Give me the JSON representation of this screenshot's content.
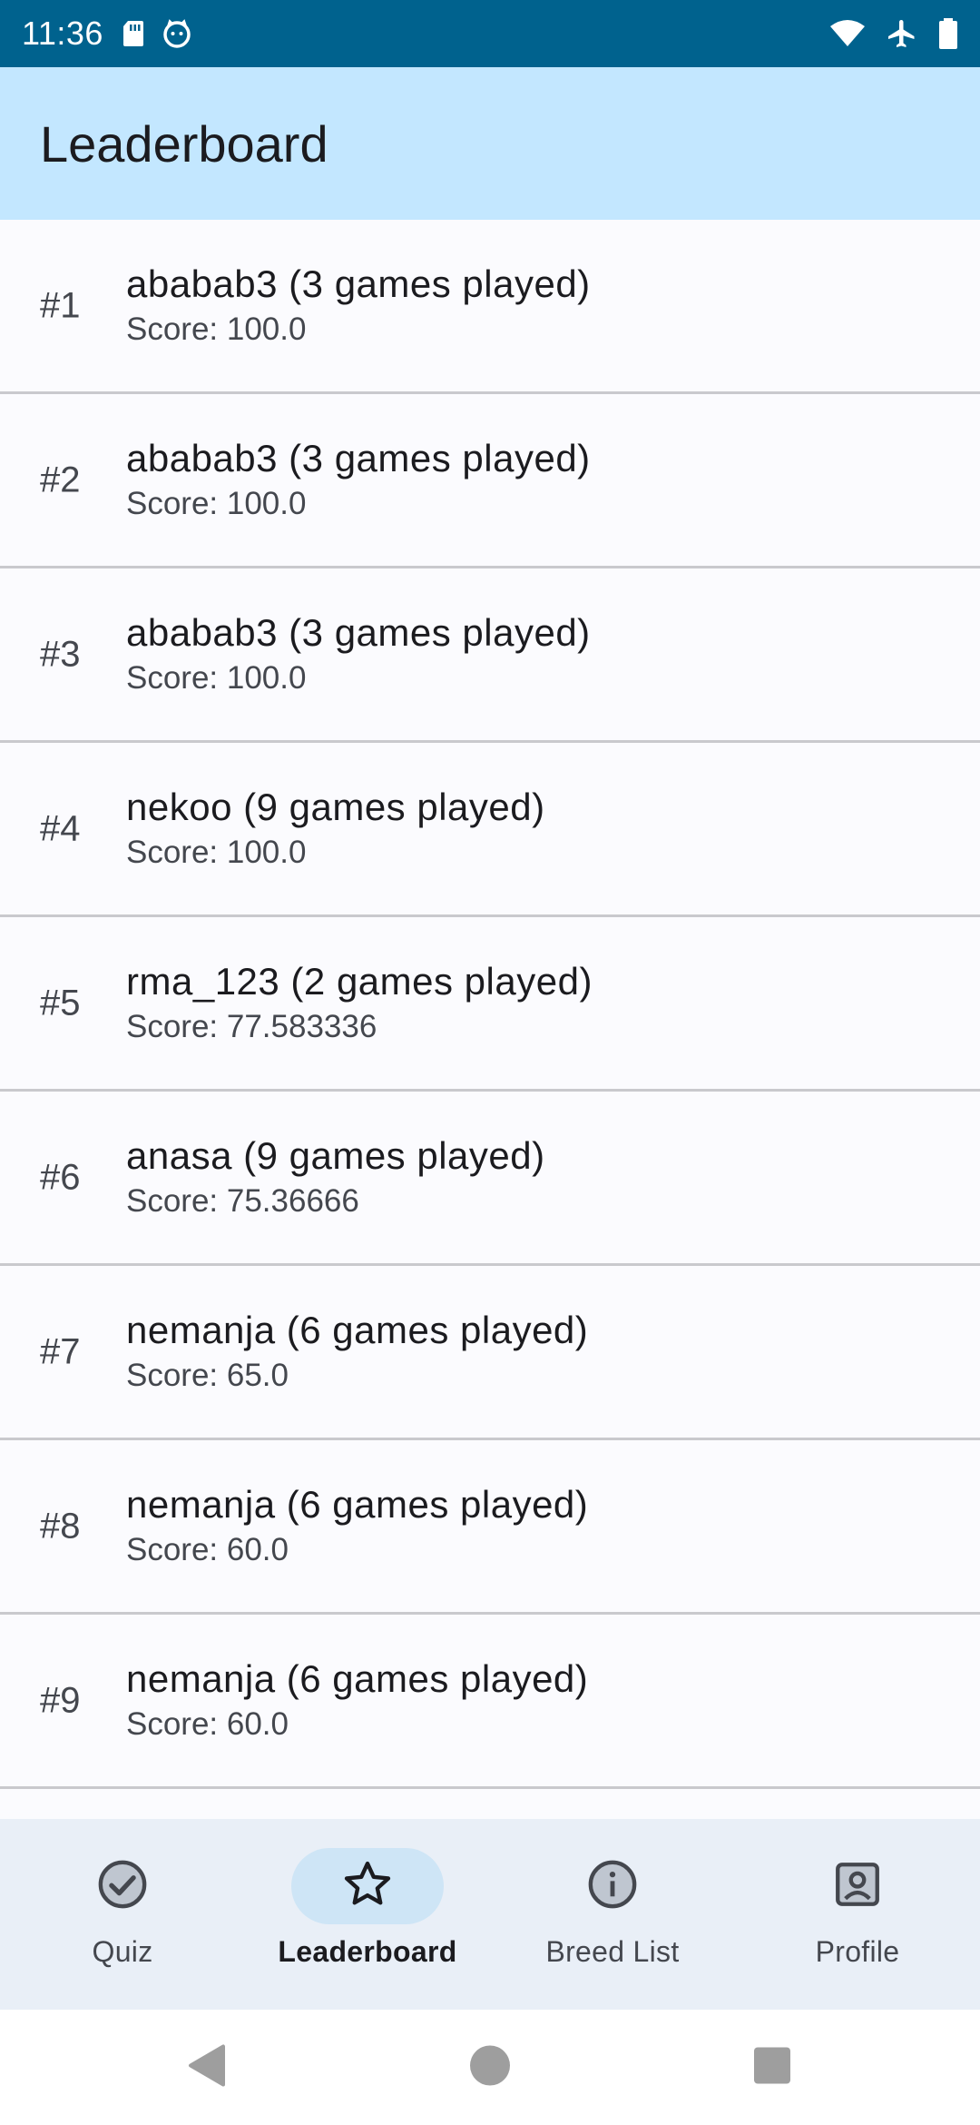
{
  "status_bar": {
    "time": "11:36",
    "left_icons": [
      "sd-card-icon",
      "cat-notification-icon"
    ],
    "right_icons": [
      "wifi-icon",
      "airplane-mode-icon",
      "battery-icon"
    ]
  },
  "app_bar": {
    "title": "Leaderboard"
  },
  "leaderboard": {
    "entries": [
      {
        "rank": "#1",
        "name": "ababab3 (3 games played)",
        "score": "Score: 100.0"
      },
      {
        "rank": "#2",
        "name": "ababab3 (3 games played)",
        "score": "Score: 100.0"
      },
      {
        "rank": "#3",
        "name": "ababab3 (3 games played)",
        "score": "Score: 100.0"
      },
      {
        "rank": "#4",
        "name": "nekoo (9 games played)",
        "score": "Score: 100.0"
      },
      {
        "rank": "#5",
        "name": "rma_123 (2 games played)",
        "score": "Score: 77.583336"
      },
      {
        "rank": "#6",
        "name": "anasa (9 games played)",
        "score": "Score: 75.36666"
      },
      {
        "rank": "#7",
        "name": "nemanja (6 games played)",
        "score": "Score: 65.0"
      },
      {
        "rank": "#8",
        "name": "nemanja (6 games played)",
        "score": "Score: 60.0"
      },
      {
        "rank": "#9",
        "name": "nemanja (6 games played)",
        "score": "Score: 60.0"
      }
    ]
  },
  "bottom_nav": {
    "items": [
      {
        "label": "Quiz",
        "icon": "check-circle-icon",
        "active": false
      },
      {
        "label": "Leaderboard",
        "icon": "star-icon",
        "active": true
      },
      {
        "label": "Breed List",
        "icon": "info-icon",
        "active": false
      },
      {
        "label": "Profile",
        "icon": "account-box-icon",
        "active": false
      }
    ]
  },
  "system_nav": {
    "buttons": [
      "back-icon",
      "home-icon",
      "recents-icon"
    ]
  },
  "colors": {
    "status_bar": "#00628E",
    "app_bar": "#C3E7FF",
    "nav_bar": "#E9EFF7",
    "nav_indicator": "#CEE5F6"
  }
}
